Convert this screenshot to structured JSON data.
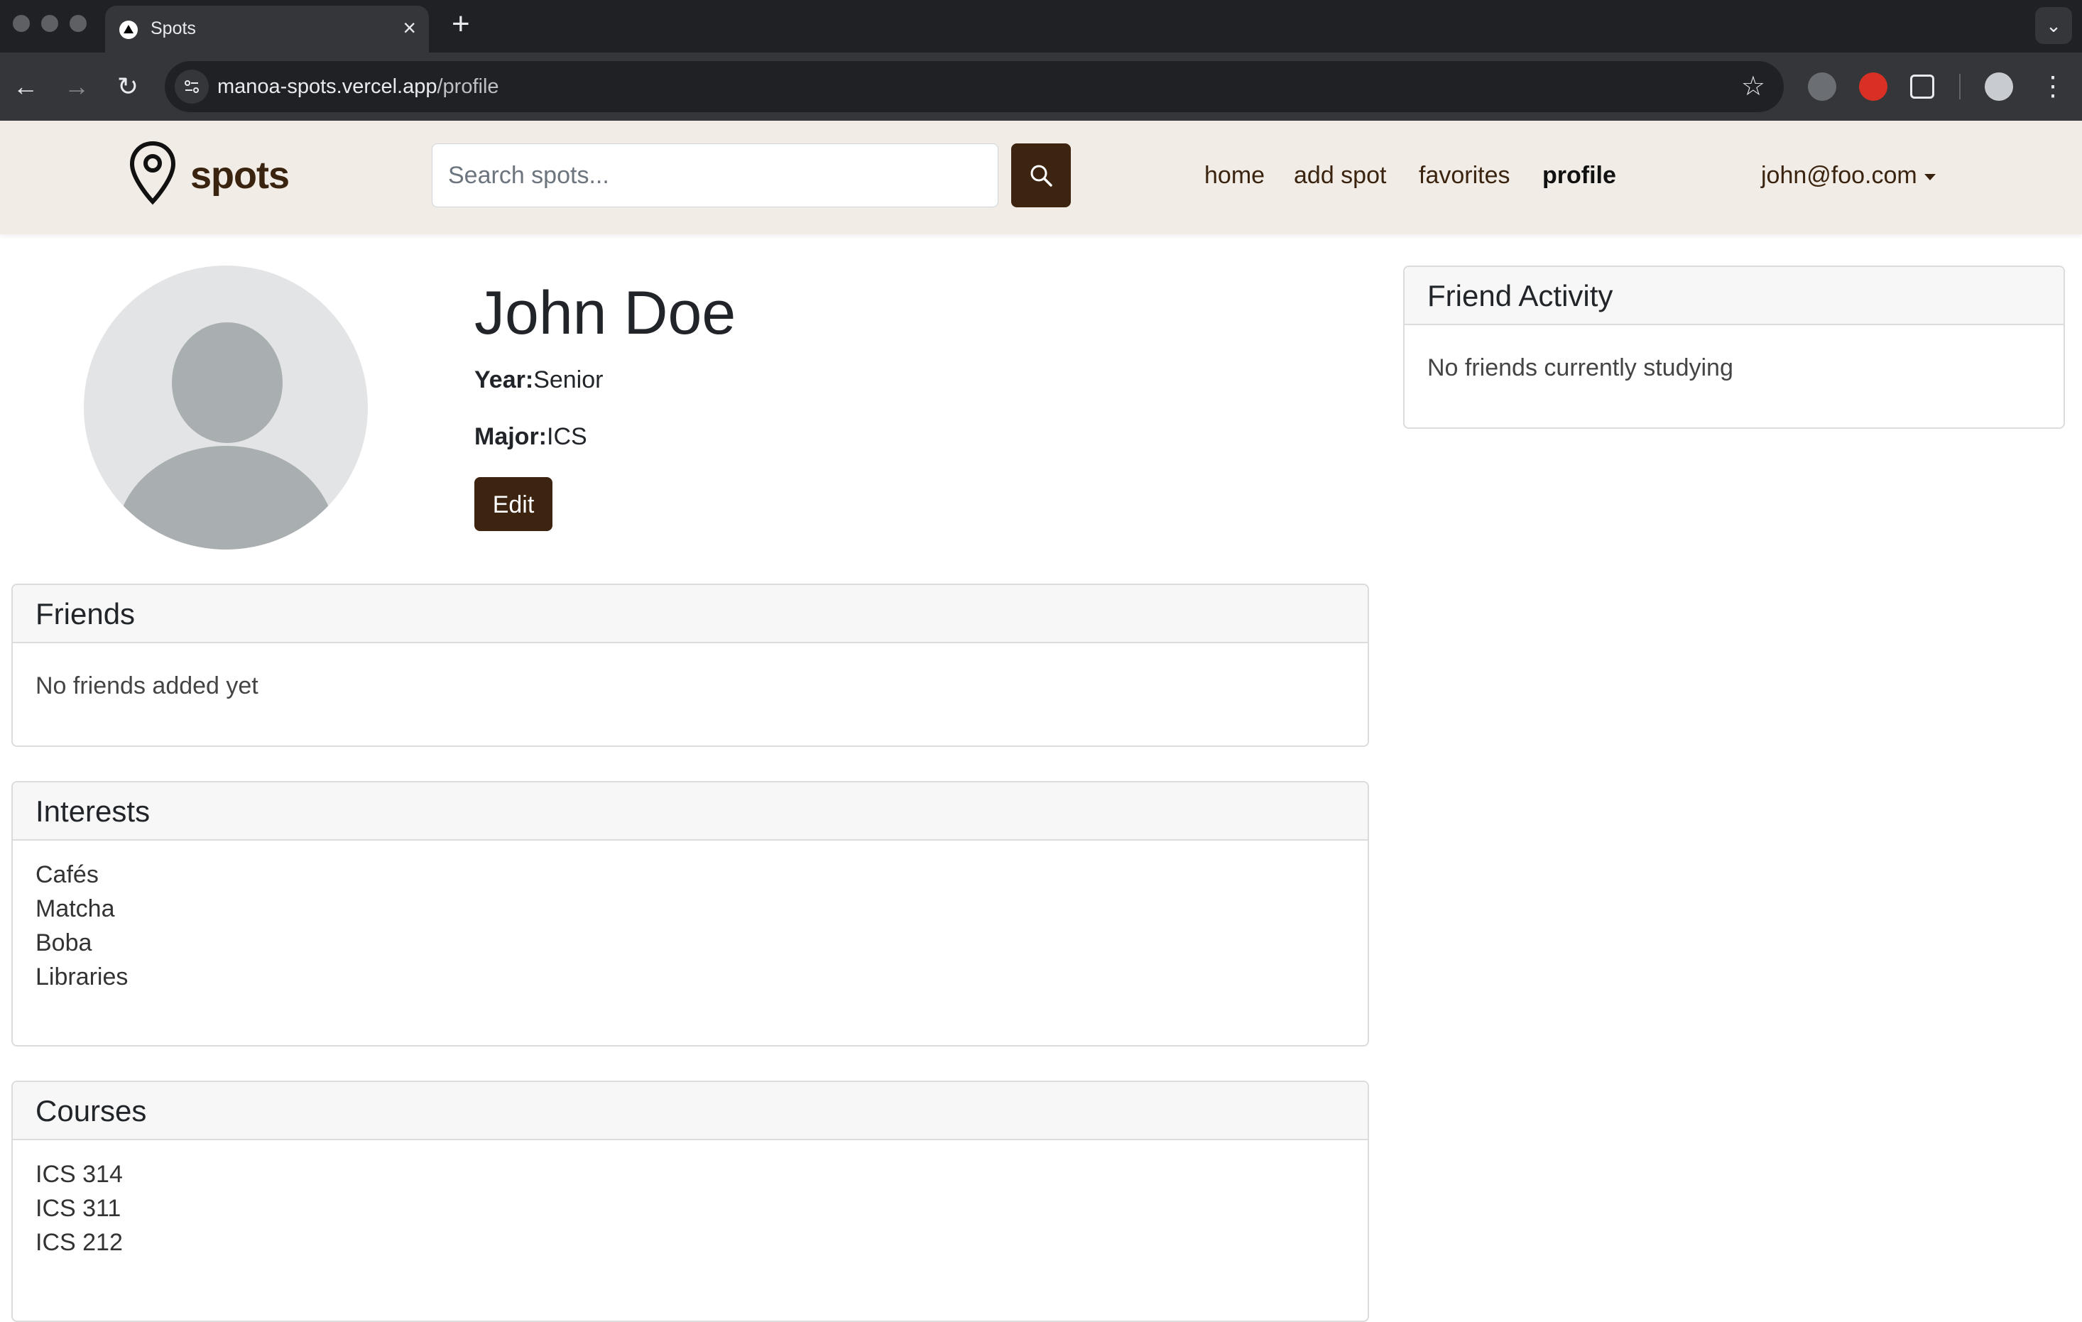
{
  "browser": {
    "tab_title": "Spots",
    "url_host": "manoa-spots.vercel.app",
    "url_path": "/profile"
  },
  "nav": {
    "brand": "spots",
    "search_placeholder": "Search spots...",
    "links": [
      "home",
      "add spot",
      "favorites",
      "profile"
    ],
    "active_link": "profile",
    "user_email": "john@foo.com"
  },
  "profile": {
    "name": "John Doe",
    "year_label": "Year:",
    "year": "Senior",
    "major_label": "Major:",
    "major": "ICS",
    "edit_label": "Edit"
  },
  "friends": {
    "title": "Friends",
    "empty": "No friends added yet"
  },
  "interests": {
    "title": "Interests",
    "items": [
      "Cafés",
      "Matcha",
      "Boba",
      "Libraries"
    ]
  },
  "courses": {
    "title": "Courses",
    "items": [
      "ICS 314",
      "ICS 311",
      "ICS 212"
    ]
  },
  "activity": {
    "title": "Friend Activity",
    "empty": "No friends currently studying"
  },
  "colors": {
    "brand_brown": "#3d2410",
    "navbar_bg": "#f1ece5"
  }
}
